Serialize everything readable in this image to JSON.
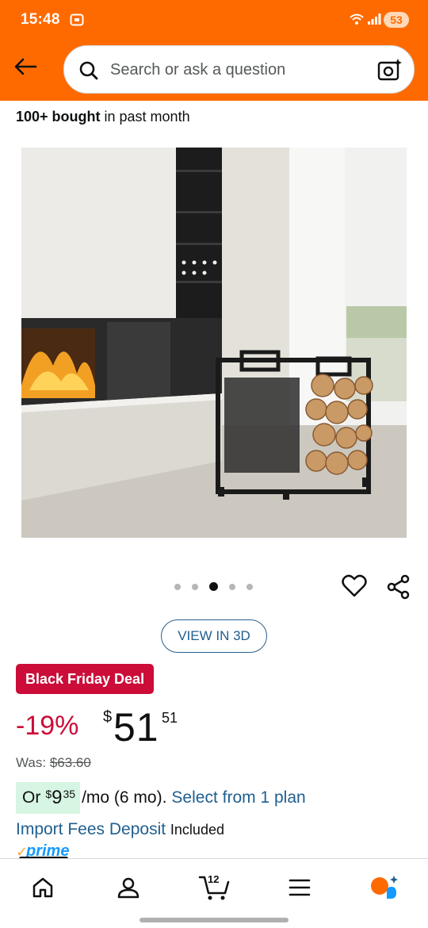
{
  "status_bar": {
    "time": "15:48",
    "battery": "53"
  },
  "header": {
    "search_placeholder": "Search or ask a question"
  },
  "social_proof": {
    "bold": "100+ bought",
    "rest": " in past month"
  },
  "carousel": {
    "dot_count": 5,
    "active_index": 2
  },
  "view_3d_label": "VIEW IN 3D",
  "deal_badge": "Black Friday Deal",
  "price": {
    "discount": "-19%",
    "currency": "$",
    "whole": "51",
    "fraction": "51"
  },
  "was_price": {
    "label": "Was: ",
    "value": "$63.60"
  },
  "monthly": {
    "prefix": "Or",
    "currency": "$",
    "whole": "9",
    "fraction": "35",
    "suffix": "/mo (6 mo).",
    "link": "Select from 1 plan"
  },
  "import_fees": {
    "link": "Import Fees Deposit",
    "status": "Included"
  },
  "prime": {
    "word": "prime"
  },
  "bottom_nav": {
    "cart_count": "12"
  },
  "colors": {
    "header_bg": "#ff6a00",
    "deal_red": "#cc0c39",
    "link_blue": "#1f5f8f",
    "installment_bg": "#d6f5e3",
    "prime_blue": "#1399ff"
  },
  "icons": [
    "back-arrow-icon",
    "search-icon",
    "camera-search-icon",
    "heart-icon",
    "share-icon",
    "home-icon",
    "account-icon",
    "cart-icon",
    "menu-icon",
    "ai-assistant-icon"
  ]
}
